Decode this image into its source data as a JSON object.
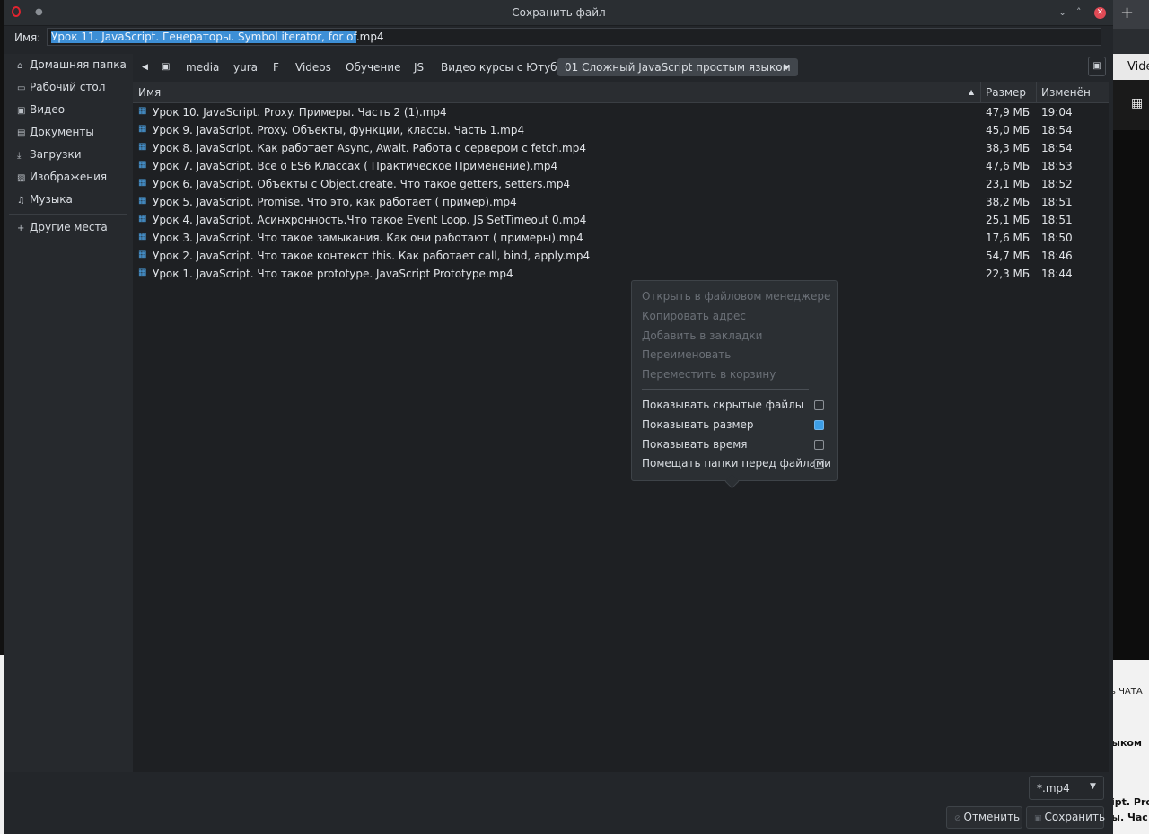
{
  "window": {
    "title": "Сохранить файл"
  },
  "name_field": {
    "label": "Имя:",
    "selected_part": "Урок 11. JavaScript. Генераторы. Symbol iterator, for of",
    "rest": ".mp4"
  },
  "sidebar": {
    "items": [
      {
        "icon": "home-icon",
        "label": "Домашняя папка"
      },
      {
        "icon": "desktop-icon",
        "label": "Рабочий стол"
      },
      {
        "icon": "video-icon",
        "label": "Видео"
      },
      {
        "icon": "documents-icon",
        "label": "Документы"
      },
      {
        "icon": "download-icon",
        "label": "Загрузки"
      },
      {
        "icon": "image-icon",
        "label": "Изображения"
      },
      {
        "icon": "music-icon",
        "label": "Музыка"
      }
    ],
    "other": {
      "icon": "plus-icon",
      "label": "Другие места"
    }
  },
  "pathbar": {
    "crumbs": [
      "media",
      "yura",
      "F",
      "Videos",
      "Обучение",
      "JS",
      "Видео курсы с Ютуба",
      "01 Сложный JavaScript простым языком"
    ]
  },
  "columns": {
    "name": "Имя",
    "size": "Размер",
    "modified": "Изменён"
  },
  "files": [
    {
      "name": "Урок 10. JavaScript. Proxy. Примеры. Часть 2 (1).mp4",
      "size": "47,9 МБ",
      "time": "19:04"
    },
    {
      "name": "Урок 9. JavaScript. Proxy. Объекты, функции, классы. Часть 1.mp4",
      "size": "45,0 МБ",
      "time": "18:54"
    },
    {
      "name": "Урок 8. JavaScript. Как работает Async, Await. Работа с сервером c fetch.mp4",
      "size": "38,3 МБ",
      "time": "18:54"
    },
    {
      "name": "Урок 7. JavaScript. Все о ES6 Классах ( Практическое Применение).mp4",
      "size": "47,6 МБ",
      "time": "18:53"
    },
    {
      "name": "Урок 6. JavaScript. Объекты с Object.create. Что такое getters, setters.mp4",
      "size": "23,1 МБ",
      "time": "18:52"
    },
    {
      "name": "Урок 5. JavaScript. Promise. Что это, как работает ( пример).mp4",
      "size": "38,2 МБ",
      "time": "18:51"
    },
    {
      "name": "Урок 4. JavaScript. Асинхронность.Что такое Event Loop. JS SetTimeout 0.mp4",
      "size": "25,1 МБ",
      "time": "18:51"
    },
    {
      "name": "Урок 3. JavaScript. Что такое замыкания. Как они работают ( примеры).mp4",
      "size": "17,6 МБ",
      "time": "18:50"
    },
    {
      "name": "Урок 2. JavaScript. Что такое контекст this. Как работает call, bind, apply.mp4",
      "size": "54,7 МБ",
      "time": "18:46"
    },
    {
      "name": "Урок 1. JavaScript. Что такое prototype. JavaScript Prototype.mp4",
      "size": "22,3 МБ",
      "time": "18:44"
    }
  ],
  "context_menu": {
    "disabled_items": [
      "Открыть в файловом менеджере",
      "Копировать адрес",
      "Добавить в закладки",
      "Переименовать",
      "Переместить в корзину"
    ],
    "toggles": [
      {
        "label": "Показывать скрытые файлы",
        "checked": false
      },
      {
        "label": "Показывать размер",
        "checked": true
      },
      {
        "label": "Показывать время",
        "checked": false
      },
      {
        "label": "Помещать папки перед файлами",
        "checked": false
      }
    ]
  },
  "filter": {
    "value": "*.mp4"
  },
  "buttons": {
    "cancel": "Отменить",
    "save": "Сохранить"
  },
  "background_fragments": {
    "tab_text": "Vide",
    "chat": "ь ЧАТА",
    "heading": "ыком",
    "line1": "ipt. Pro",
    "line2": "ы. Час"
  }
}
